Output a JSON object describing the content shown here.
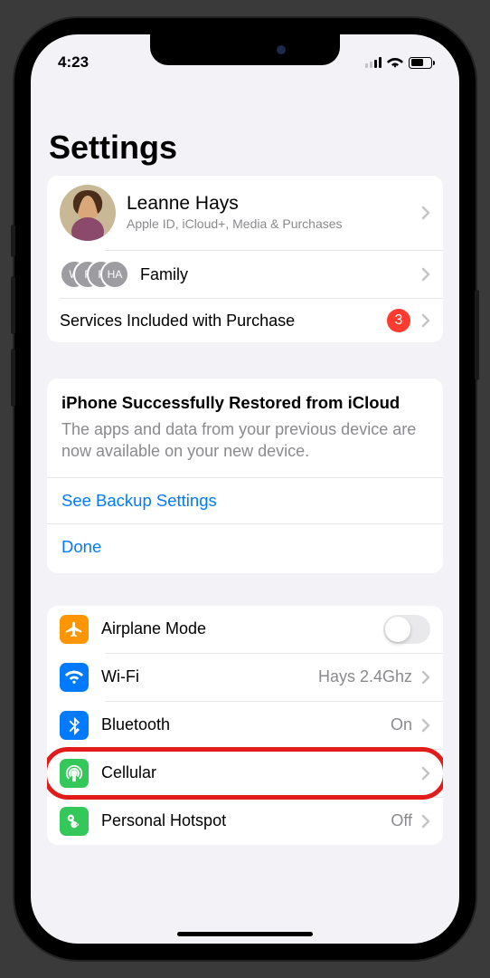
{
  "status": {
    "time": "4:23"
  },
  "page": {
    "title": "Settings"
  },
  "profile": {
    "name": "Leanne Hays",
    "subtitle": "Apple ID, iCloud+, Media & Purchases"
  },
  "family": {
    "label": "Family",
    "initials": [
      "W",
      "F",
      "F",
      "HA"
    ]
  },
  "services": {
    "label": "Services Included with Purchase",
    "badge": "3"
  },
  "restore": {
    "title": "iPhone Successfully Restored from iCloud",
    "text": "The apps and data from your previous device are now available on your new device.",
    "backup_link": "See Backup Settings",
    "done_link": "Done"
  },
  "rows": {
    "airplane": {
      "label": "Airplane Mode",
      "icon_bg": "#ff9500"
    },
    "wifi": {
      "label": "Wi-Fi",
      "detail": "Hays 2.4Ghz",
      "icon_bg": "#007aff"
    },
    "bluetooth": {
      "label": "Bluetooth",
      "detail": "On",
      "icon_bg": "#007aff"
    },
    "cellular": {
      "label": "Cellular",
      "icon_bg": "#34c759"
    },
    "hotspot": {
      "label": "Personal Hotspot",
      "detail": "Off",
      "icon_bg": "#34c759"
    }
  }
}
